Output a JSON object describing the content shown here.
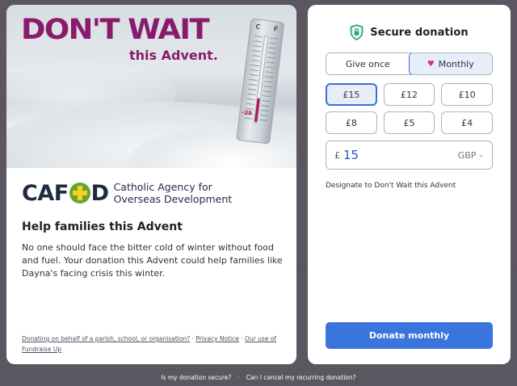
{
  "campaign": {
    "headline": "DON'T WAIT",
    "subheadline": "this Advent.",
    "thermometer": {
      "scale_c": "C",
      "scale_f": "F",
      "reading": "-25"
    }
  },
  "organization": {
    "logo_text_1": "CAF",
    "logo_text_2": "D",
    "tagline_line1": "Catholic Agency for",
    "tagline_line2": "Overseas Development"
  },
  "appeal": {
    "title": "Help families this Advent",
    "description": "No one should face the bitter cold of winter without food and fuel. Your donation this Advent could help families like Dayna's facing crisis this winter."
  },
  "footer_links": {
    "parish": "Donating on behalf of a parish, school, or organisation?",
    "privacy": "Privacy Notice",
    "fundraise_up": "Our use of Fundraise Up",
    "separator": "·"
  },
  "donation_form": {
    "secure_label": "Secure donation",
    "frequency": {
      "once": "Give once",
      "monthly": "Monthly",
      "selected": "monthly"
    },
    "amounts": [
      "£15",
      "£12",
      "£10",
      "£8",
      "£5",
      "£4"
    ],
    "selected_amount_index": 0,
    "custom": {
      "currency_symbol": "£",
      "value": "15",
      "currency": "GBP"
    },
    "designation": "Designate to Don't Wait this Advent",
    "submit_label": "Donate monthly"
  },
  "bottom_links": {
    "secure": "Is my donation secure?",
    "separator": "·",
    "cancel": "Can I cancel my recurring donation?"
  },
  "colors": {
    "brand_magenta": "#8a1b6b",
    "brand_navy": "#1f2a44",
    "accent_blue": "#3a74dd",
    "shield_green": "#1f9e6e",
    "heart": "#d9317a"
  }
}
